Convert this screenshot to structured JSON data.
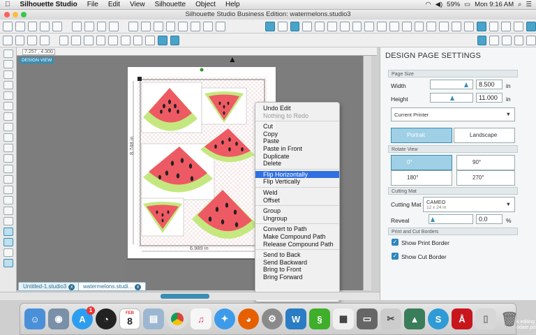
{
  "menubar": {
    "apple": "",
    "app_name": "Silhouette Studio",
    "items": [
      "File",
      "Edit",
      "View",
      "Silhouette",
      "Object",
      "Help"
    ],
    "battery": "59%",
    "clock": "Mon 9:16 AM"
  },
  "window": {
    "title": "Silhouette Studio Business Edition: watermelons.studio3"
  },
  "canvas": {
    "view_label": "DESIGN VIEW",
    "coords": "7.257 , 4.300",
    "height_dim": "8.748 in",
    "width_dim": "6.989 in"
  },
  "context_menu": {
    "items": [
      {
        "label": "Undo Edit",
        "state": "normal"
      },
      {
        "label": "Nothing to Redo",
        "state": "disabled"
      },
      {
        "sep": true
      },
      {
        "label": "Cut",
        "state": "normal"
      },
      {
        "label": "Copy",
        "state": "normal"
      },
      {
        "label": "Paste",
        "state": "normal"
      },
      {
        "label": "Paste in Front",
        "state": "normal"
      },
      {
        "label": "Duplicate",
        "state": "normal"
      },
      {
        "label": "Delete",
        "state": "normal"
      },
      {
        "sep": true
      },
      {
        "label": "Flip Horizontally",
        "state": "highlighted"
      },
      {
        "label": "Flip Vertically",
        "state": "normal"
      },
      {
        "sep": true
      },
      {
        "label": "Weld",
        "state": "normal"
      },
      {
        "label": "Offset",
        "state": "normal"
      },
      {
        "sep": true
      },
      {
        "label": "Group",
        "state": "normal"
      },
      {
        "label": "Ungroup",
        "state": "normal"
      },
      {
        "sep": true
      },
      {
        "label": "Convert to Path",
        "state": "normal"
      },
      {
        "label": "Make Compound Path",
        "state": "normal"
      },
      {
        "label": "Release Compound Path",
        "state": "normal"
      },
      {
        "sep": true
      },
      {
        "label": "Send to Back",
        "state": "normal"
      },
      {
        "label": "Send Backward",
        "state": "normal"
      },
      {
        "label": "Bring to Front",
        "state": "normal"
      },
      {
        "label": "Bring Forward",
        "state": "normal"
      }
    ]
  },
  "panel": {
    "title": "DESIGN PAGE SETTINGS",
    "page_size": {
      "section": "Page Size",
      "width_label": "Width",
      "width_value": "8.500",
      "height_label": "Height",
      "height_value": "11.000",
      "unit": "in",
      "printer": "Current Printer"
    },
    "orientation": {
      "portrait": "Portrait",
      "landscape": "Landscape",
      "selected": "portrait"
    },
    "rotate_view": {
      "section": "Rotate View",
      "r0": "0°",
      "r90": "90°",
      "r180": "180°",
      "r270": "270°"
    },
    "cutting_mat": {
      "section": "Cutting Mat",
      "label": "Cutting Mat",
      "value": "CAMEO",
      "sub": "12 x 24 in",
      "reveal_label": "Reveal",
      "reveal_value": "0.0",
      "reveal_unit": "%"
    },
    "borders": {
      "section": "Print and Cut Borders",
      "show_print": "Show Print Border",
      "show_cut": "Show Cut Border",
      "print_checked": true,
      "cut_checked": true
    }
  },
  "tabs": [
    {
      "label": "Untitled-1.studio3"
    },
    {
      "label": "watermelons.studi..."
    }
  ],
  "dock": {
    "calendar_month": "FEB",
    "calendar_day": "8",
    "appstore_badge": "1",
    "desktop_text": "k editing\nodate.pd"
  },
  "colors": {
    "accent": "#3a8db3",
    "watermelon_red": "#ee5a63",
    "rind_green": "#c4e87f",
    "menu_highlight": "#2f6fe0"
  }
}
